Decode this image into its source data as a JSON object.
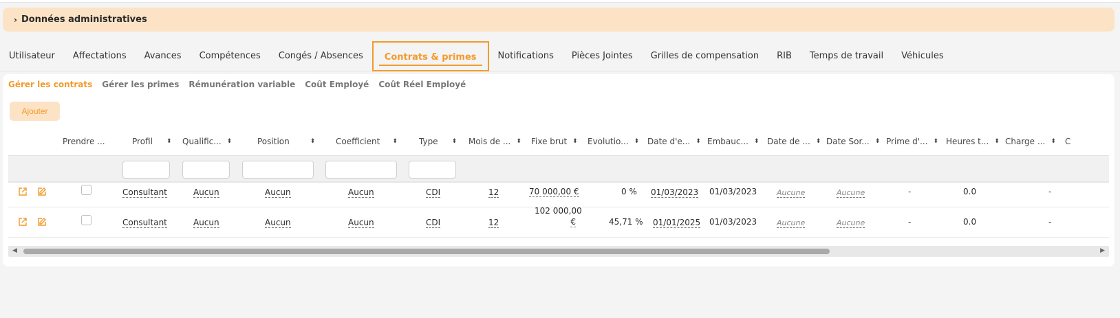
{
  "accordion": {
    "chevron": "›",
    "title": "Données administratives"
  },
  "tabs": [
    {
      "label": "Utilisateur"
    },
    {
      "label": "Affectations"
    },
    {
      "label": "Avances"
    },
    {
      "label": "Compétences"
    },
    {
      "label": "Congés / Absences"
    },
    {
      "label": "Contrats & primes"
    },
    {
      "label": "Notifications"
    },
    {
      "label": "Pièces Jointes"
    },
    {
      "label": "Grilles de compensation"
    },
    {
      "label": "RIB"
    },
    {
      "label": "Temps de travail"
    },
    {
      "label": "Véhicules"
    }
  ],
  "active_tab": "Contrats & primes",
  "subtabs": [
    "Gérer les contrats",
    "Gérer les primes",
    "Rémunération variable",
    "Coût Employé",
    "Coût Réel Employé"
  ],
  "add_label": "Ajouter",
  "columns": {
    "prendre": "Prendre ...",
    "profil": "Profil",
    "qualif": "Qualific...",
    "position": "Position",
    "coefficient": "Coefficient",
    "type": "Type",
    "mois": "Mois de ...",
    "fixe": "Fixe brut",
    "evolution": "Evolutio...",
    "date_e": "Date d'e...",
    "embauche": "Embauc...",
    "date_de": "Date de ...",
    "date_sortie": "Date Sor...",
    "prime": "Prime d'...",
    "heures": "Heures t...",
    "charge": "Charge ...",
    "c": "C"
  },
  "rows": [
    {
      "profil": "Consultant",
      "qualif": "Aucun",
      "position": "Aucun",
      "coefficient": "Aucun",
      "type": "CDI",
      "mois": "12",
      "fixe": "70 000,00 €",
      "evolution": "0 %",
      "date_e": "01/03/2023",
      "embauche": "01/03/2023",
      "date_de": "Aucune",
      "date_sortie": "Aucune",
      "prime": "-",
      "heures": "0.0",
      "charge": "-"
    },
    {
      "profil": "Consultant",
      "qualif": "Aucun",
      "position": "Aucun",
      "coefficient": "Aucun",
      "type": "CDI",
      "mois": "12",
      "fixe_line1": "102 000,00",
      "fixe_line2": "€",
      "evolution": "45,71 %",
      "date_e": "01/01/2025",
      "embauche": "01/03/2023",
      "date_de": "Aucune",
      "date_sortie": "Aucune",
      "prime": "-",
      "heures": "0.0",
      "charge": "-"
    }
  ],
  "scroll": {
    "left": "◀",
    "right": "▶"
  },
  "colors": {
    "accent": "#f39a2b",
    "accent_light": "#fde3c5"
  }
}
